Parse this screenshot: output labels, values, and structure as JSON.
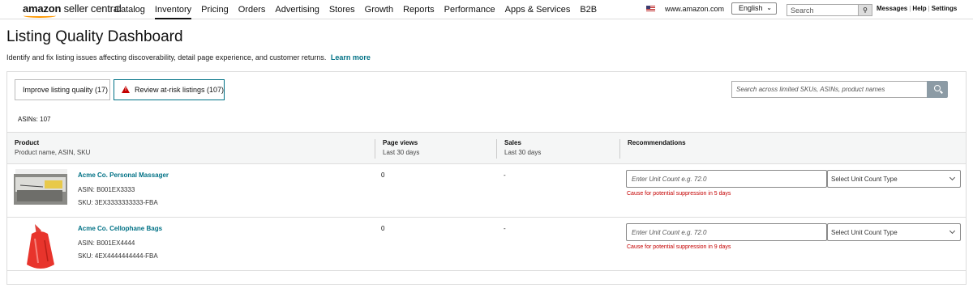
{
  "topnav": {
    "logo_bold": "amazon",
    "logo_rest": " seller central",
    "items": [
      "Catalog",
      "Inventory",
      "Pricing",
      "Orders",
      "Advertising",
      "Stores",
      "Growth",
      "Reports",
      "Performance",
      "Apps & Services",
      "B2B"
    ],
    "active_item": "Inventory",
    "marketplace": "www.amazon.com",
    "language": "English",
    "search_placeholder": "Search",
    "messages": "Messages",
    "help": "Help",
    "settings": "Settings",
    "sep": "|"
  },
  "page": {
    "title": "Listing Quality Dashboard",
    "description": "Identify and fix listing issues affecting discoverability, detail page experience, and customer returns.",
    "learn_more": "Learn more"
  },
  "tabs": [
    {
      "label": "Improve listing quality (17)"
    },
    {
      "label": "Review at-risk listings (107)"
    }
  ],
  "panel_search_placeholder": "Search across limited SKUs, ASINs, product names",
  "asins_count": "ASINs: 107",
  "table": {
    "headers": {
      "product": {
        "title": "Product",
        "sub": "Product name, ASIN, SKU"
      },
      "page_views": {
        "title": "Page views",
        "sub": "Last 30 days"
      },
      "sales": {
        "title": "Sales",
        "sub": "Last 30 days"
      },
      "recommendations": {
        "title": "Recommendations"
      }
    },
    "rows": [
      {
        "name": "Acme Co. Personal Massager",
        "asin": "ASIN: B001EX3333",
        "sku": "SKU: 3EX3333333333-FBA",
        "page_views": "0",
        "sales": "-",
        "unit_count_placeholder": "Enter Unit Count e.g. 72.0",
        "unit_type": "Select Unit Count Type",
        "cause": "Cause for potential suppression in 5 days"
      },
      {
        "name": "Acme Co. Cellophane Bags",
        "asin": "ASIN: B001EX4444",
        "sku": "SKU: 4EX4444444444-FBA",
        "page_views": "0",
        "sales": "-",
        "unit_count_placeholder": "Enter Unit Count e.g. 72.0",
        "unit_type": "Select Unit Count Type",
        "cause": "Cause for potential suppression in 9 days"
      }
    ]
  },
  "colors": {
    "link": "#007185",
    "warning": "#c40000",
    "brand_accent": "#ff9900",
    "search_button": "#8c9ba5"
  }
}
